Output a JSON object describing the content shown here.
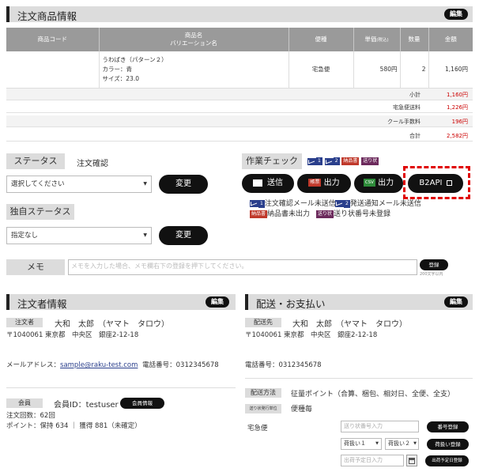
{
  "order_items": {
    "title": "注文商品情報",
    "edit": "編集",
    "columns": [
      "商品コード",
      "商品名",
      "バリエーション名",
      "便種",
      "単価",
      "(税込)",
      "数量",
      "金額"
    ],
    "rows": [
      {
        "code": "",
        "name": "うわばき（パターン２）",
        "color": "カラー：青",
        "size": "サイズ：23.0",
        "shipping": "宅急便",
        "price": "580円",
        "qty": "2",
        "amount": "1,160円"
      }
    ],
    "summary": [
      {
        "label": "小計",
        "value": "1,160円"
      },
      {
        "label": "宅急便送料",
        "value": "1,226円"
      },
      {
        "label": "クール手数料",
        "value": "196円"
      },
      {
        "label": "合計",
        "value": "2,582円"
      }
    ]
  },
  "status": {
    "label": "ステータス",
    "current": "注文確認",
    "select_value": "選択してください",
    "change": "変更"
  },
  "custom_status": {
    "label": "独自ステータス",
    "select_value": "指定なし",
    "change": "変更"
  },
  "work_check": {
    "label": "作業チェック",
    "tag1": "1",
    "tag2": "2",
    "tag_invoice": "納品書",
    "tag_slip": "送り状",
    "send": "送信",
    "tag_ledger": "帳票",
    "print": "出力",
    "tag_csv": "CSV",
    "csv_print": "出力",
    "b2api": "B2API",
    "notice1_num": "1",
    "notice1": "注文確認メール未送信",
    "notice2_num": "2",
    "notice2": "発送通知メール未送信",
    "notice3_tag": "納品書",
    "notice3": "納品書未出力",
    "notice4_tag": "送り状",
    "notice4": "送り状番号未登録"
  },
  "memo": {
    "label": "メモ",
    "placeholder": "メモを入力した場合、メモ欄右下の登録を押下してください。",
    "register": "登録",
    "limit": "200文字以内"
  },
  "customer": {
    "title": "注文者情報",
    "edit": "編集",
    "role": "注文者",
    "name": "大和　太郎　（ヤマト　タロウ）",
    "address": "〒1040061 東京都　中央区　銀座2-12-18",
    "email_label": "メールアドレス：",
    "email": "sample@raku-test.com",
    "phone": "電話番号：0312345678",
    "member_label": "会員",
    "member_id": "会員ID：testuser",
    "member_info": "会員情報",
    "orders": "注文回数：62回",
    "points": "ポイント：保持 634 ｜ 獲得 881（未確定）"
  },
  "shipping": {
    "title": "配送・お支払い",
    "edit": "編集",
    "role": "配送先",
    "name": "大和　太郎　（ヤマト　タロウ）",
    "address": "〒1040061 東京都　中央区　銀座2-12-18",
    "phone": "電話番号：0312345678",
    "method_label": "配送方法",
    "method": "征量ポイント（合算、梱包、相対日、全便、全支）",
    "slip_unit_label": "送り状発行単位",
    "slip_unit": "便種毎",
    "carrier": "宅急便",
    "slip_placeholder": "送り状番号入力",
    "slip_register": "番号登録",
    "handling1": "荷扱い１",
    "handling2": "荷扱い２",
    "handling_register": "荷扱い登録",
    "ship_date_placeholder": "出荷予定日入力",
    "ship_date_register": "出荷予定日登録"
  }
}
